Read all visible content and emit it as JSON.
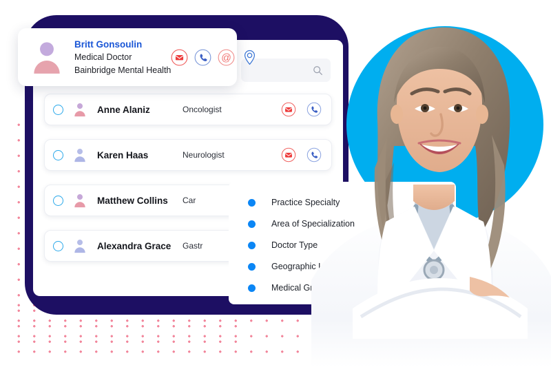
{
  "contact_card": {
    "name": "Britt Gonsoulin",
    "role": "Medical Doctor",
    "organization": "Bainbridge Mental Health",
    "avatar_icon": "person-avatar-icon",
    "actions": [
      {
        "icon": "email-icon",
        "color": "#f0615f"
      },
      {
        "icon": "phone-icon",
        "color": "#3b6fd4"
      },
      {
        "icon": "at-sign-icon",
        "color": "#f0615f"
      },
      {
        "icon": "map-pin-icon",
        "color": "#3b6fd4"
      }
    ]
  },
  "app_panel": {
    "search": {
      "placeholder": "",
      "value": "",
      "icon": "search-icon"
    },
    "rows": [
      {
        "checkbox_icon": "circle-checkbox-icon",
        "avatar_icon": "person-avatar-icon",
        "name": "Anne Alaniz",
        "specialty": "Oncologist",
        "actions": [
          "email-icon",
          "phone-icon"
        ]
      },
      {
        "checkbox_icon": "circle-checkbox-icon",
        "avatar_icon": "person-avatar-icon",
        "name": "Karen Haas",
        "specialty": "Neurologist",
        "actions": [
          "email-icon",
          "phone-icon"
        ]
      },
      {
        "checkbox_icon": "circle-checkbox-icon",
        "avatar_icon": "person-avatar-icon",
        "name": "Matthew Collins",
        "specialty": "Car",
        "actions": [
          "email-icon",
          "phone-icon"
        ]
      },
      {
        "checkbox_icon": "circle-checkbox-icon",
        "avatar_icon": "person-avatar-icon",
        "name": "Alexandra Grace",
        "specialty": "Gastr",
        "actions": [
          "email-icon",
          "phone-icon"
        ]
      }
    ]
  },
  "feature_panel": {
    "bullet_icon": "blue-dot-icon",
    "items": [
      {
        "label": "Practice Specialty"
      },
      {
        "label": "Area of Specialization"
      },
      {
        "label": "Doctor Type"
      },
      {
        "label": "Geographic Location"
      },
      {
        "label": "Medical Group Affiliation"
      }
    ]
  },
  "decor": {
    "photo_alt": "smiling-female-doctor-white-coat-stethoscope",
    "dot_grid_color": "#f2869b",
    "navy_blob_color": "#1d0f63",
    "cyan_circle_color": "#00aeef",
    "accent_blue": "#0b86f5",
    "name_blue": "#1a56d6",
    "email_red": "#f0615f",
    "phone_blue": "#3b6fd4"
  }
}
